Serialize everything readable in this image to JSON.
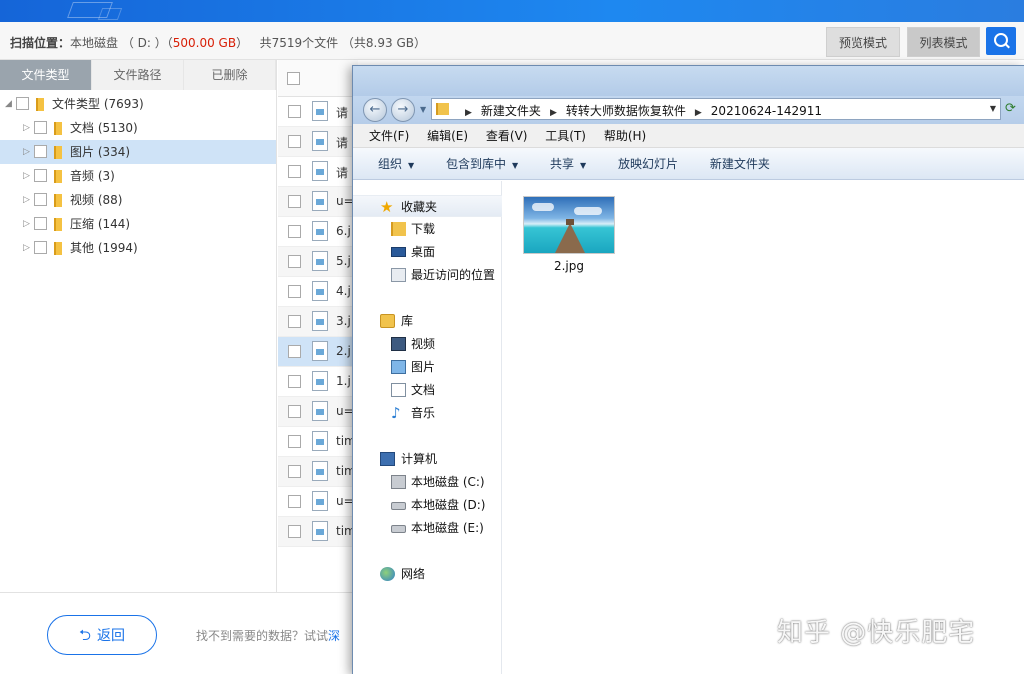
{
  "scan": {
    "label": "扫描位置：",
    "location": "本地磁盘 （ D: ）（",
    "size": "500.00 GB",
    "size_close": "）",
    "total": "共7519个文件 （共8.93 GB）"
  },
  "modes": {
    "preview": "预览模式",
    "list": "列表模式"
  },
  "tabs": [
    "文件类型",
    "文件路径",
    "已删除"
  ],
  "tree": [
    {
      "label": "文件类型 (7693)"
    },
    {
      "label": "文档 (5130)"
    },
    {
      "label": "图片 (334)"
    },
    {
      "label": "音频 (3)"
    },
    {
      "label": "视频 (88)"
    },
    {
      "label": "压缩 (144)"
    },
    {
      "label": "其他 (1994)"
    }
  ],
  "files": [
    "请",
    "请",
    "请",
    "u=",
    "6.j",
    "5.j",
    "4.j",
    "3.j",
    "2.j",
    "1.j",
    "u=",
    "tim",
    "tim",
    "u=",
    "tim"
  ],
  "bottom": {
    "back": "返回",
    "hint": "找不到需要的数据？试试",
    "hint_link": "深"
  },
  "explorer": {
    "breadcrumbs": [
      "新建文件夹",
      "转转大师数据恢复软件",
      "20210624-142911"
    ],
    "menu": [
      "文件(F)",
      "编辑(E)",
      "查看(V)",
      "工具(T)",
      "帮助(H)"
    ],
    "toolbar": [
      {
        "label": "组织",
        "dropdown": true
      },
      {
        "label": "包含到库中",
        "dropdown": true
      },
      {
        "label": "共享",
        "dropdown": true
      },
      {
        "label": "放映幻灯片",
        "dropdown": false
      },
      {
        "label": "新建文件夹",
        "dropdown": false
      }
    ],
    "nav": {
      "favorites": "收藏夹",
      "downloads": "下载",
      "desktop": "桌面",
      "recent": "最近访问的位置",
      "libraries": "库",
      "videos": "视频",
      "pictures": "图片",
      "documents": "文档",
      "music": "音乐",
      "computer": "计算机",
      "drive_c": "本地磁盘 (C:)",
      "drive_d": "本地磁盘 (D:)",
      "drive_e": "本地磁盘 (E:)",
      "network": "网络"
    },
    "file": {
      "name": "2.jpg"
    }
  },
  "watermark": "知乎 @快乐肥宅"
}
